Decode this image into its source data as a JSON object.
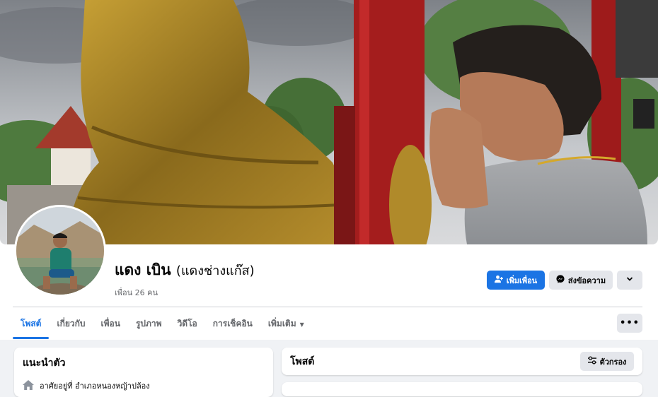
{
  "profile": {
    "name": "แดง เบิน",
    "nickname": "(แดงช่างแก๊ส)",
    "friends_count": "เพื่อน 26 คน"
  },
  "actions": {
    "add_friend": "เพิ่มเพื่อน",
    "message": "ส่งข้อความ"
  },
  "tabs": [
    {
      "label": "โพสต์"
    },
    {
      "label": "เกี่ยวกับ"
    },
    {
      "label": "เพื่อน"
    },
    {
      "label": "รูปภาพ"
    },
    {
      "label": "วิดีโอ"
    },
    {
      "label": "การเช็คอิน"
    },
    {
      "label": "เพิ่มเติม"
    }
  ],
  "intro": {
    "title": "แนะนำตัว",
    "lives_in": "อาศัยอยู่ที่ อำเภอหนองหญ้าปล้อง"
  },
  "posts": {
    "title": "โพสต์",
    "filter": "ตัวกรอง"
  },
  "colors": {
    "accent": "#1b74e4",
    "secondary_button": "#e4e6eb",
    "background": "#f0f2f5"
  }
}
